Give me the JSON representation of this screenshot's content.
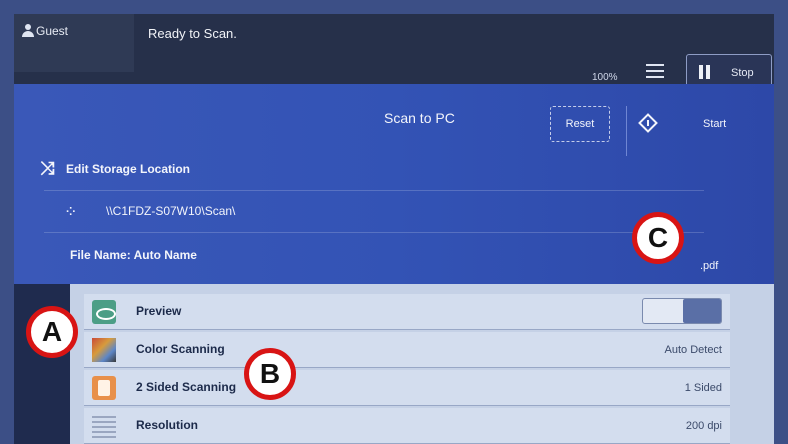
{
  "topbar": {
    "user": "Guest",
    "status": "Ready to Scan.",
    "zoom": "100%",
    "stop_label": "Stop"
  },
  "panel": {
    "title": "Scan to PC",
    "reset_label": "Reset",
    "start_label": "Start",
    "edit_location": "Edit Storage Location",
    "path": "\\\\C1FDZ-S07W10\\Scan\\",
    "file_name": "File Name: Auto Name",
    "extension": ".pdf"
  },
  "settings": [
    {
      "label": "Preview",
      "value": "",
      "icon": "eye-icon"
    },
    {
      "label": "Color Scanning",
      "value": "Auto Detect",
      "icon": "color-palette-icon"
    },
    {
      "label": "2 Sided Scanning",
      "value": "1 Sided",
      "icon": "two-sided-icon"
    },
    {
      "label": "Resolution",
      "value": "200 dpi",
      "icon": "grid-icon"
    }
  ],
  "annotations": [
    "A",
    "B",
    "C"
  ],
  "colors": {
    "annotation_ring": "#d81414",
    "panel_blue": "#3a58b8"
  }
}
